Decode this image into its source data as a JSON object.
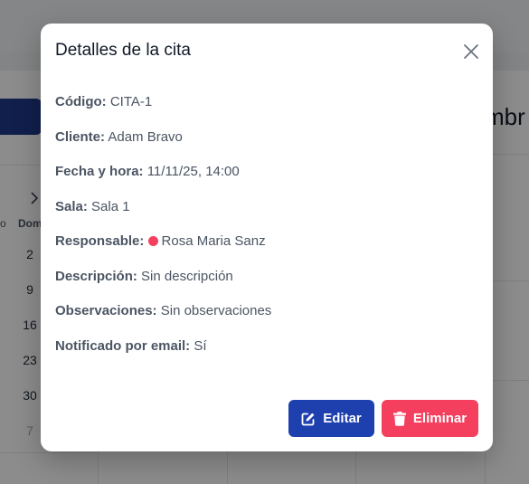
{
  "background": {
    "month_partial": "mbr",
    "weekday_header": "Dom",
    "weekday_prev_partial": "o",
    "days": [
      {
        "label": "2",
        "muted": false
      },
      {
        "label": "9",
        "muted": false
      },
      {
        "label": "16",
        "muted": false
      },
      {
        "label": "23",
        "muted": false
      },
      {
        "label": "30",
        "muted": false
      },
      {
        "label": "7",
        "muted": true
      }
    ]
  },
  "modal": {
    "title": "Detalles de la cita",
    "fields": {
      "codigo": {
        "label": "Código:",
        "value": "CITA-1"
      },
      "cliente": {
        "label": "Cliente:",
        "value": "Adam Bravo"
      },
      "fecha_hora": {
        "label": "Fecha y hora:",
        "value": "11/11/25, 14:00"
      },
      "sala": {
        "label": "Sala:",
        "value": "Sala 1"
      },
      "responsable": {
        "label": "Responsable:",
        "value": "Rosa Maria Sanz",
        "dot_color": "#f43f5e"
      },
      "descripcion": {
        "label": "Descripción:",
        "value": "Sin descripción"
      },
      "observaciones": {
        "label": "Observaciones:",
        "value": "Sin observaciones"
      },
      "notificado": {
        "label": "Notificado por email:",
        "value": "Sí"
      }
    },
    "buttons": {
      "edit": {
        "label": "Editar",
        "icon": "edit-icon",
        "color": "#1e40af"
      },
      "delete": {
        "label": "Eliminar",
        "icon": "trash-icon",
        "color": "#f43f5e"
      }
    },
    "close_icon": "close-icon"
  }
}
